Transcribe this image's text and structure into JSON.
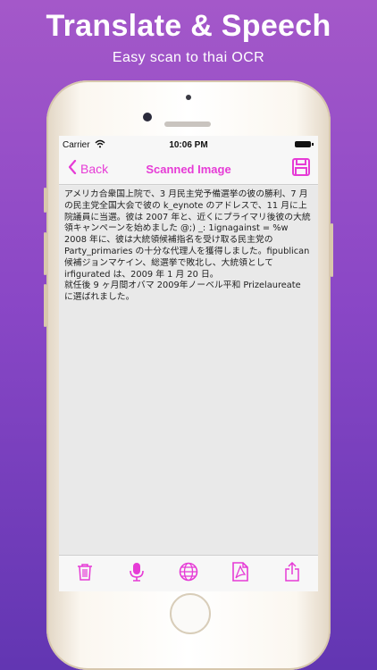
{
  "promo": {
    "headline": "Translate & Speech",
    "subline": "Easy scan to thai OCR"
  },
  "status_bar": {
    "carrier": "Carrier",
    "time": "10:06 PM"
  },
  "nav": {
    "back_label": "Back",
    "title": "Scanned Image"
  },
  "ocr_text": "アメリカ合衆国上院で、3 月民主党予備選挙の彼の勝利、7 月の民主党全国大会で彼の k_eynote のアドレスで、11 月に上院議員に当選。彼は 2007 年と、近くにプライマリ後彼の大統領キャンペーンを始めました @;) _: 1ignagainst = %w\n2008 年に、彼は大統領候補指名を受け取る民主党の Party_primaries の十分な代理人を獲得しました。fipublican 候補ジョンマケイン、総選挙で敗北し、大統領として irfigurated は、2009 年 1 月 20 日。\n就任後 9 ヶ月間オバマ 2009年ノーベル平和 Prizelaureate に選ばれました。",
  "toolbar": {
    "icons": [
      "trash-icon",
      "microphone-icon",
      "globe-icon",
      "pdf-icon",
      "share-icon"
    ]
  },
  "colors": {
    "accent": "#e63bd6",
    "background_top": "#a458c9",
    "background_bottom": "#6236b2"
  }
}
